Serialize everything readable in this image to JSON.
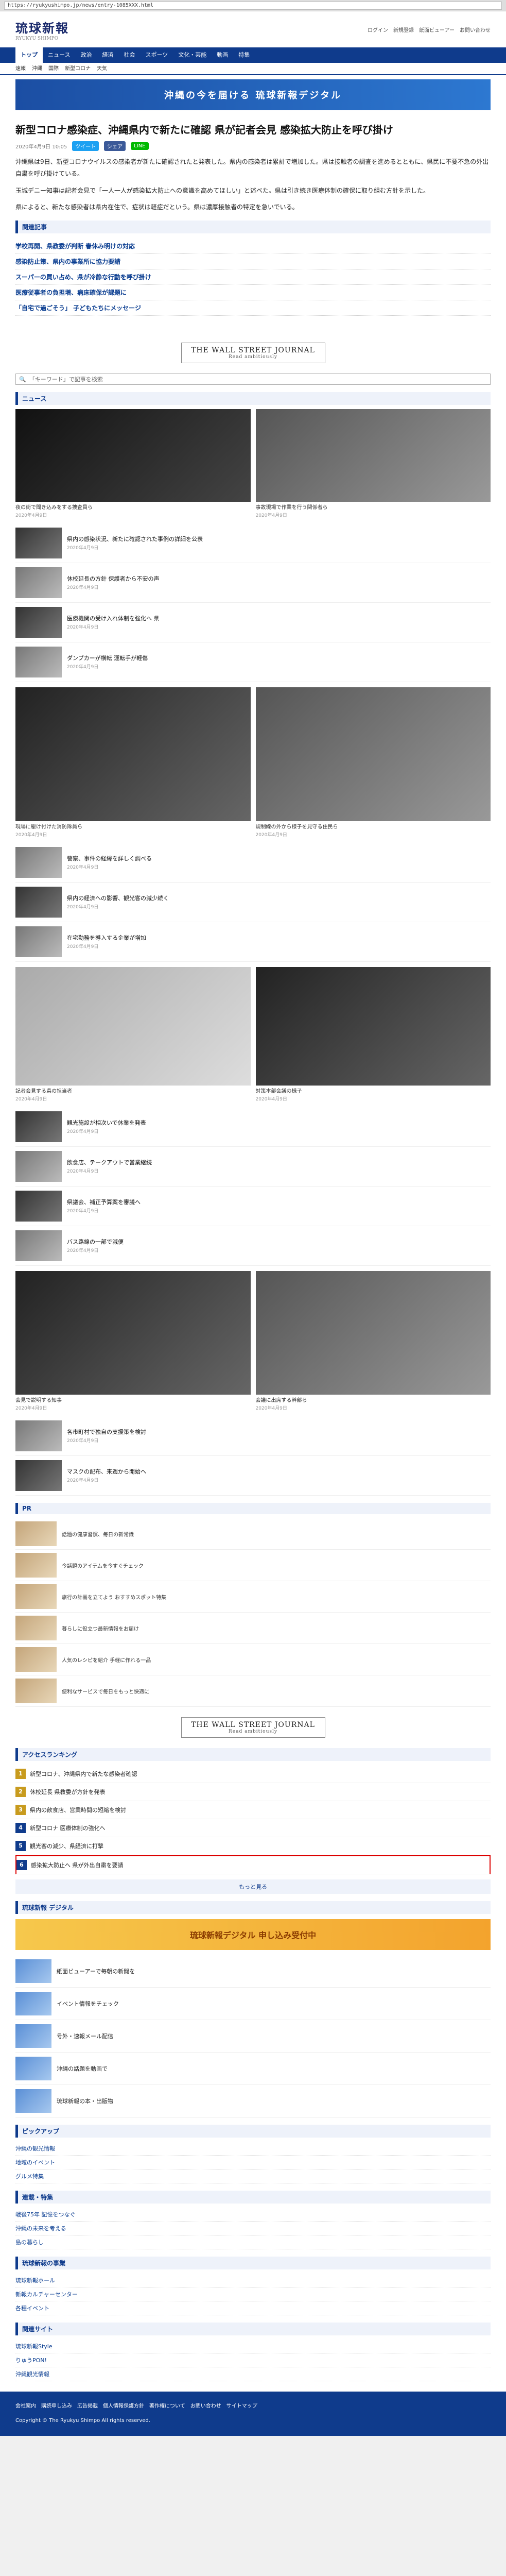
{
  "browser": {
    "url": "https://ryukyushimpo.jp/news/entry-1085XXX.html"
  },
  "header": {
    "logo": "琉球新報",
    "logo_sub": "RYUKYU SHIMPO",
    "links": [
      "ログイン",
      "新規登録",
      "紙面ビューアー",
      "お問い合わせ"
    ]
  },
  "gnav": [
    "トップ",
    "ニュース",
    "政治",
    "経済",
    "社会",
    "スポーツ",
    "文化・芸能",
    "動画",
    "特集"
  ],
  "subnav": [
    "速報",
    "沖縄",
    "国際",
    "新型コロナ",
    "天気"
  ],
  "top_banner": "沖縄の今を届ける 琉球新報デジタル",
  "article": {
    "title": "新型コロナ感染症、沖縄県内で新たに確認 県が記者会見 感染拡大防止を呼び掛け",
    "date": "2020年4月9日 10:05",
    "sns": [
      "ツイート",
      "シェア",
      "LINE"
    ],
    "paragraphs": [
      "沖縄県は9日、新型コロナウイルスの感染者が新たに確認されたと発表した。県内の感染者は累計で増加した。県は接触者の調査を進めるとともに、県民に不要不急の外出自粛を呼び掛けている。",
      "玉城デニー知事は記者会見で「一人一人が感染拡大防止への意識を高めてほしい」と述べた。県は引き続き医療体制の確保に取り組む方針を示した。",
      "県によると、新たな感染者は県内在住で、症状は軽症だという。県は濃厚接触者の特定を急いでいる。"
    ],
    "related_heading": "関連記事",
    "related": [
      "学校再開、県教委が判断 春休み明けの対応",
      "感染防止策、県内の事業所に協力要請",
      "スーパーの買い占め、県が冷静な行動を呼び掛け",
      "医療従事者の負担増、病床確保が課題に",
      "「自宅で過ごそう」 子どもたちにメッセージ"
    ]
  },
  "wsj": {
    "title": "THE WALL STREET JOURNAL",
    "sub": "Read ambitiously"
  },
  "search": {
    "icon": "search-icon",
    "placeholder": "「キーワード」で記事を検索"
  },
  "latest": {
    "heading": "ニュース",
    "photos_top": [
      {
        "caption": "夜の街で聞き込みをする捜査員ら",
        "date": "2020年4月9日"
      },
      {
        "caption": "事故現場で作業を行う関係者ら",
        "date": "2020年4月9日"
      }
    ],
    "rows": [
      {
        "text": "県内の感染状況、新たに確認された事例の詳細を公表",
        "date": "2020年4月9日"
      },
      {
        "text": "休校延長の方針 保護者から不安の声",
        "date": "2020年4月9日"
      },
      {
        "text": "医療機関の受け入れ体制を強化へ 県",
        "date": "2020年4月9日"
      },
      {
        "text": "ダンプカーが横転 運転手が軽傷",
        "date": "2020年4月9日"
      }
    ],
    "photos_mid": [
      {
        "caption": "現場に駆け付けた消防隊員ら",
        "date": "2020年4月9日"
      },
      {
        "caption": "規制線の外から様子を見守る住民ら",
        "date": "2020年4月9日"
      }
    ],
    "rows2": [
      {
        "text": "警察、事件の経緯を詳しく調べる",
        "date": "2020年4月9日"
      },
      {
        "text": "県内の経済への影響、観光客の減少続く",
        "date": "2020年4月9日"
      },
      {
        "text": "在宅勤務を導入する企業が増加",
        "date": "2020年4月9日"
      }
    ],
    "photos_bottom": [
      {
        "caption": "記者会見する県の担当者",
        "date": "2020年4月9日"
      },
      {
        "caption": "対策本部会議の様子",
        "date": "2020年4月9日"
      }
    ],
    "rows3": [
      {
        "text": "観光施設が相次いで休業を発表",
        "date": "2020年4月9日"
      },
      {
        "text": "飲食店、テークアウトで営業継続",
        "date": "2020年4月9日"
      },
      {
        "text": "県議会、補正予算案を審議へ",
        "date": "2020年4月9日"
      },
      {
        "text": "バス路線の一部で減便",
        "date": "2020年4月9日"
      }
    ],
    "triple_photos": [
      {
        "caption": "会見で説明する知事",
        "date": "2020年4月9日"
      },
      {
        "caption": "会議に出席する幹部ら",
        "date": "2020年4月9日"
      },
      {
        "caption": "",
        "date": ""
      }
    ],
    "rows4": [
      {
        "text": "各市町村で独自の支援策を検討",
        "date": "2020年4月9日"
      },
      {
        "text": "マスクの配布、来週から開始へ",
        "date": "2020年4月9日"
      }
    ]
  },
  "sponsored": {
    "label": "PR",
    "items": [
      {
        "text": "話題の健康習慣、毎日の新常識"
      },
      {
        "text": "今話題のアイテムを今すぐチェック"
      },
      {
        "text": "旅行の計画を立てよう おすすめスポット特集"
      },
      {
        "text": "暮らしに役立つ最新情報をお届け"
      },
      {
        "text": "人気のレシピを紹介 手軽に作れる一品"
      },
      {
        "text": "便利なサービスで毎日をもっと快適に"
      }
    ]
  },
  "ranking": {
    "heading": "アクセスランキング",
    "items": [
      "新型コロナ、沖縄県内で新たな感染者確認",
      "休校延長 県教委が方針を発表",
      "県内の飲食店、営業時間の短縮を検討",
      "新型コロナ 医療体制の強化へ",
      "観光客の減少、県経済に打撃"
    ],
    "highlight": "感染拡大防止へ 県が外出自粛を要請"
  },
  "wsj2": {
    "title": "THE WALL STREET JOURNAL",
    "sub": "Read ambitiously"
  },
  "pager": "もっと見る",
  "promos": {
    "heading": "琉球新報 デジタル",
    "banner": "琉球新報デジタル 申し込み受付中",
    "items": [
      "紙面ビューアーで毎朝の新聞を",
      "イベント情報をチェック",
      "号外・速報メール配信",
      "沖縄の話題を動画で",
      "琉球新報の本・出版物"
    ]
  },
  "more_sections": [
    {
      "heading": "ピックアップ",
      "items": [
        "沖縄の観光情報",
        "地域のイベント",
        "グルメ特集"
      ]
    },
    {
      "heading": "連載・特集",
      "items": [
        "戦後75年 記憶をつなぐ",
        "沖縄の未来を考える",
        "島の暮らし"
      ]
    },
    {
      "heading": "琉球新報の事業",
      "items": [
        "琉球新報ホール",
        "新報カルチャーセンター",
        "各種イベント"
      ]
    },
    {
      "heading": "関連サイト",
      "items": [
        "琉球新報Style",
        "りゅうPON!",
        "沖縄観光情報"
      ]
    }
  ],
  "footer": {
    "links": [
      "会社案内",
      "購読申し込み",
      "広告掲載",
      "個人情報保護方針",
      "著作権について",
      "お問い合わせ",
      "サイトマップ"
    ],
    "copyright": "Copyright © The Ryukyu Shimpo All rights reserved."
  },
  "colors": {
    "brand": "#0f3b8c",
    "accent": "#c89b1e"
  }
}
